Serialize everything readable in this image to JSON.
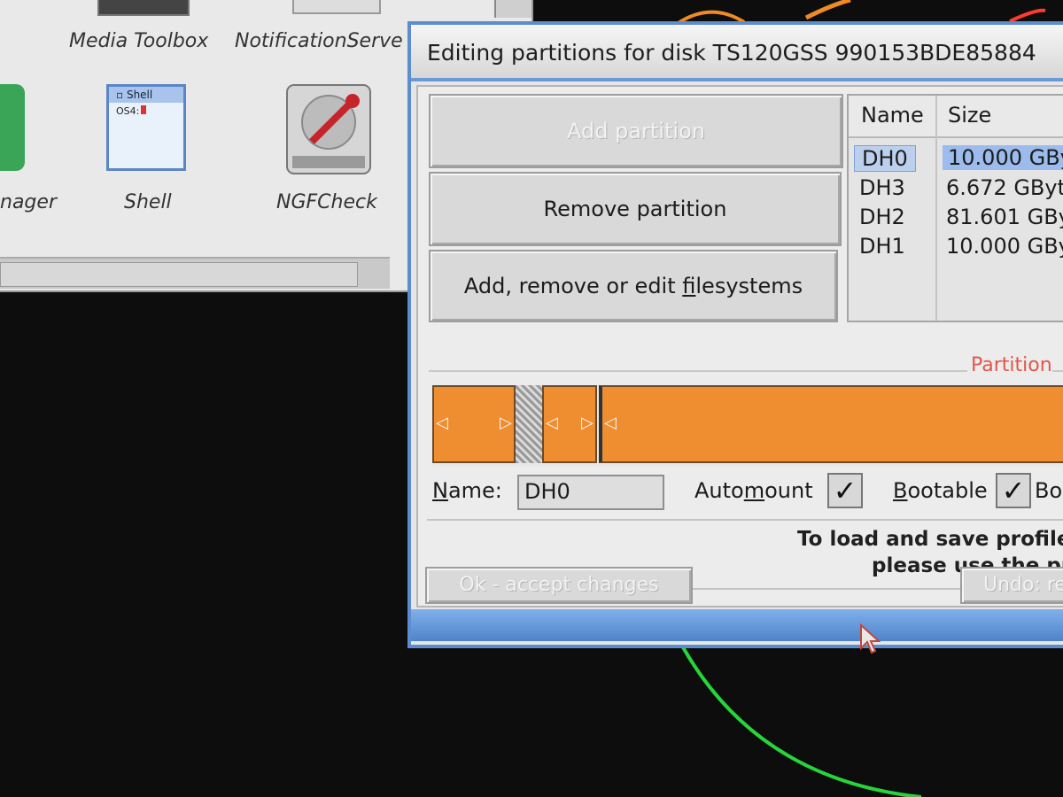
{
  "workbench": {
    "icons": [
      {
        "label": "Media Toolbox",
        "icon": "toolbox-icon"
      },
      {
        "label": "NotificationServe",
        "icon": "notification-icon"
      },
      {
        "label": "nager",
        "icon": "manager-icon"
      },
      {
        "label": "Shell",
        "icon": "shell-window-icon"
      },
      {
        "label": "NGFCheck",
        "icon": "disk-repair-icon"
      }
    ],
    "shell_icon_title": "Shell",
    "shell_icon_prompt": "OS4:"
  },
  "dialog": {
    "title": "Editing partitions for disk TS120GSS 990153BDE85884",
    "buttons": {
      "add_partition": "Add partition",
      "remove_partition": "Remove partition",
      "edit_fs_pre": "Add, remove or edit ",
      "edit_fs_ul": "f",
      "edit_fs_post": "ilesystems",
      "ok": "Ok - accept changes",
      "undo": "Undo: re"
    },
    "partition_list": {
      "columns": [
        "Name",
        "Size"
      ],
      "rows": [
        {
          "name": "DH0",
          "size": "10.000 GBy",
          "selected": true
        },
        {
          "name": "DH3",
          "size": "6.672 GByt",
          "selected": false
        },
        {
          "name": "DH2",
          "size": "81.601 GBy",
          "selected": false
        },
        {
          "name": "DH1",
          "size": "10.000 GBy",
          "selected": false
        }
      ]
    },
    "group_title": "Partition",
    "fields": {
      "name_label_ul": "N",
      "name_label_rest": "ame:",
      "name_value": "DH0",
      "automount_pre": "Auto",
      "automount_ul": "m",
      "automount_post": "ount",
      "automount_checked": true,
      "bootable_ul": "B",
      "bootable_rest": "ootable",
      "bootable_checked": true,
      "boot_cut": "Bo"
    },
    "info": {
      "line1": "To load and save profiles",
      "line2": "please use the pu"
    }
  },
  "colors": {
    "partition_fill": "#ef8d31",
    "title_accent": "#5b8dd0",
    "group_title": "#e0574a",
    "selection": "#9bbcec"
  }
}
